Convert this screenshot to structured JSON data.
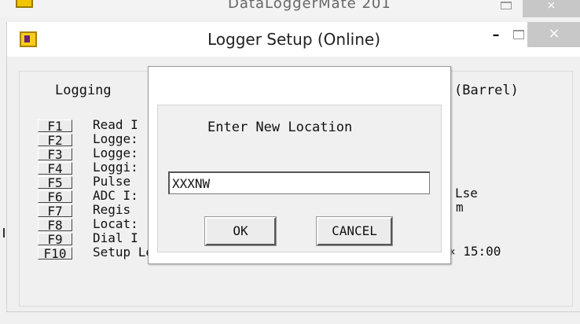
{
  "background_window": {
    "title": "DataLoggerMate 201",
    "close_glyph": "×"
  },
  "window": {
    "title": "Logger Setup (Online)",
    "minimize_glyph": "–",
    "close_glyph": "×"
  },
  "main": {
    "heading_left": "Logging",
    "heading_right": "(Barrel)",
    "function_keys": [
      {
        "key": "F1",
        "label": "Read I"
      },
      {
        "key": "F2",
        "label": "Logge:"
      },
      {
        "key": "F3",
        "label": "Logge:"
      },
      {
        "key": "F4",
        "label": "Loggi:"
      },
      {
        "key": "F5",
        "label": "Pulse"
      },
      {
        "key": "F6",
        "label": "ADC I:"
      },
      {
        "key": "F7",
        "label": "Regis"
      },
      {
        "key": "F8",
        "label": "Locat:"
      },
      {
        "key": "F9",
        "label": "Dial I"
      },
      {
        "key": "F10",
        "label": "Setup Logger"
      }
    ],
    "right_fragments": {
      "pulse_tail": "Lse",
      "adc_tail": "m",
      "dial_tail": "« 15:00"
    }
  },
  "dialog": {
    "prompt": "Enter New Location",
    "location_value": "XXXNW",
    "ok_label": "OK",
    "cancel_label": "CANCEL"
  }
}
